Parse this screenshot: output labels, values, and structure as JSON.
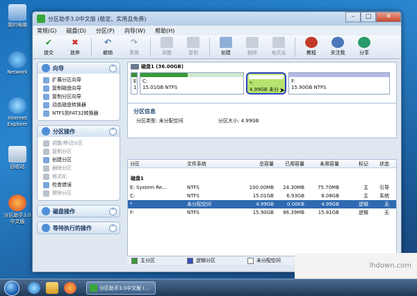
{
  "desktop": {
    "icons": [
      {
        "label": "我的电脑"
      },
      {
        "label": "Network"
      },
      {
        "label": "Internet Explorer"
      },
      {
        "label": "回收站"
      },
      {
        "label": "分区助手3.0中文版"
      }
    ]
  },
  "window": {
    "title": "分区助手3.0中文版 (稳定、实用且免费)",
    "menu": [
      "常规(G)",
      "磁盘(D)",
      "分区(P)",
      "向导(W)",
      "帮助(H)"
    ],
    "toolbar": [
      {
        "label": "提交",
        "icon": "check-icon",
        "color": "#2a9a2a"
      },
      {
        "label": "放弃",
        "icon": "cross-icon",
        "color": "#d0302a"
      },
      {
        "label": "撤销",
        "icon": "undo-icon",
        "color": "#4a78b8"
      },
      {
        "label": "重做",
        "icon": "redo-icon",
        "color": "#9aa6b4"
      },
      {
        "label": "调整",
        "icon": "resize-icon",
        "color": "#9aa6b4"
      },
      {
        "label": "复制",
        "icon": "copy-icon",
        "color": "#9aa6b4"
      },
      {
        "label": "创建",
        "icon": "create-icon",
        "color": "#4a78b8"
      },
      {
        "label": "删除",
        "icon": "delete-icon",
        "color": "#9aa6b4"
      },
      {
        "label": "格式化",
        "icon": "format-icon",
        "color": "#9aa6b4"
      },
      {
        "label": "教程",
        "icon": "tutorial-icon",
        "color": "#c23a2a"
      },
      {
        "label": "关注我",
        "icon": "follow-icon",
        "color": "#4a78b8"
      },
      {
        "label": "分享",
        "icon": "share-icon",
        "color": "#2a9a6a"
      }
    ],
    "left": {
      "wizard": {
        "title": "向导",
        "items": [
          "扩展分区向导",
          "复制磁盘向导",
          "复制分区向导",
          "动态磁盘转换器",
          "NTFS到FAT32转换器"
        ]
      },
      "partition_ops": {
        "title": "分区操作",
        "items": [
          {
            "label": "调整/移动分区",
            "enabled": false
          },
          {
            "label": "复制分区",
            "enabled": false
          },
          {
            "label": "创建分区",
            "enabled": true
          },
          {
            "label": "删除分区",
            "enabled": false
          },
          {
            "label": "格式化",
            "enabled": false
          },
          {
            "label": "检查错误",
            "enabled": true
          },
          {
            "label": "擦除分区",
            "enabled": false
          }
        ]
      },
      "disk_ops": {
        "title": "磁盘操作"
      },
      "pending": {
        "title": "等待执行的操作"
      }
    },
    "diskmap": {
      "disk_label": "磁盘1 (36.00GB)",
      "parts": [
        {
          "line1": "E",
          "line2": "1"
        },
        {
          "line1": "C:",
          "line2": "15.01GB NTFS"
        },
        {
          "line1": "*:",
          "line2": "4.99GB 未分"
        },
        {
          "line1": "F:",
          "line2": "15.90GB NTFS"
        }
      ]
    },
    "info": {
      "heading": "分区信息",
      "type_label": "分区类型: 未分配空间",
      "size_label": "分区大小: 4.99GB"
    },
    "table": {
      "headers": [
        "分区",
        "文件系统",
        "总容量",
        "已用容量",
        "未用容量",
        "标记",
        "状态"
      ],
      "group": "磁盘1",
      "rows": [
        [
          "E: System Re...",
          "NTFS",
          "100.00MB",
          "24.30MB",
          "75.70MB",
          "主",
          "引导"
        ],
        [
          "C:",
          "NTFS",
          "15.01GB",
          "6.93GB",
          "8.08GB",
          "主",
          "系统"
        ],
        [
          "*",
          "未分配空间",
          "4.99GB",
          "0.00KB",
          "4.99GB",
          "逻辑",
          "无"
        ],
        [
          "F:",
          "NTFS",
          "15.90GB",
          "86.39MB",
          "15.81GB",
          "逻辑",
          "无"
        ]
      ]
    },
    "legend": [
      "主分区",
      "逻辑分区",
      "未分配空间"
    ]
  },
  "taskbar": {
    "task_label": "分区助手3.0中文版 (..."
  },
  "watermark": "lhdown.com"
}
